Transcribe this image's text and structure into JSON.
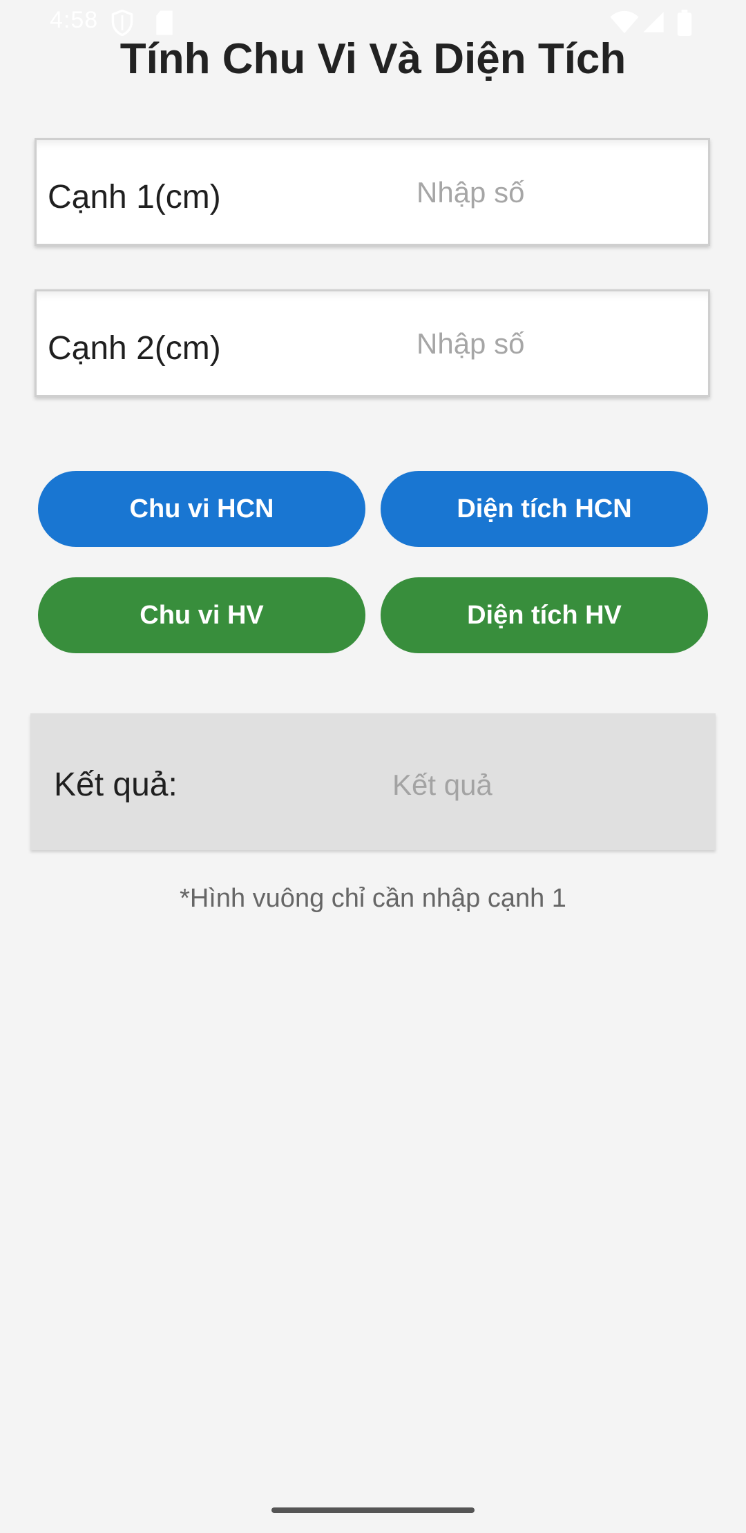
{
  "status_bar": {
    "time": "4:58",
    "icons": [
      "shield-icon",
      "sd-card-icon",
      "wifi-icon",
      "signal-icon",
      "battery-icon"
    ]
  },
  "title": "Tính Chu Vi Và Diện Tích",
  "inputs": [
    {
      "label": "Cạnh 1(cm)",
      "value": "",
      "placeholder": "Nhập số"
    },
    {
      "label": "Cạnh 2(cm)",
      "value": "",
      "placeholder": "Nhập số"
    }
  ],
  "buttons": {
    "rect_perimeter": "Chu vi HCN",
    "rect_area": "Diện tích HCN",
    "square_perimeter": "Chu vi HV",
    "square_area": "Diện tích HV"
  },
  "result": {
    "label": "Kết quả:",
    "value_placeholder": "Kết quả"
  },
  "hint": "*Hình vuông chỉ cần nhập cạnh 1",
  "colors": {
    "background": "#f4f4f4",
    "rect_buttons": "#1976d2",
    "square_buttons": "#388e3c",
    "result_background": "#e0e0e0"
  }
}
